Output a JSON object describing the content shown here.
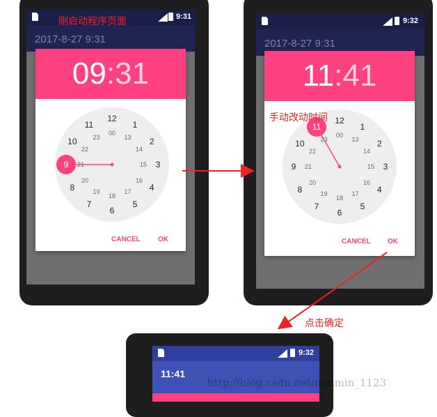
{
  "annotations": {
    "first_launch": "刚启动程序页面",
    "manual_change": "手动改动时间",
    "click_confirm": "点击确定"
  },
  "screen1": {
    "status_time": "9:31",
    "appbar_text": "2017-8-27 9:31",
    "header_hours": "09",
    "header_colon": ":",
    "header_minutes": "31",
    "selected_hour": "9",
    "cancel_label": "CANCEL",
    "ok_label": "OK"
  },
  "screen2": {
    "status_time": "9:32",
    "appbar_text": "2017-8-27 9:31",
    "header_hours": "11",
    "header_colon": ":",
    "header_minutes": "41",
    "selected_hour": "11",
    "cancel_label": "CANCEL",
    "ok_label": "OK"
  },
  "screen3": {
    "status_time": "9:32",
    "appbar_text": "11:41"
  },
  "clock": {
    "outer": [
      "12",
      "1",
      "2",
      "3",
      "4",
      "5",
      "6",
      "7",
      "8",
      "9",
      "10",
      "11"
    ],
    "inner": [
      "00",
      "13",
      "14",
      "15",
      "16",
      "17",
      "18",
      "19",
      "20",
      "21",
      "22",
      "23"
    ]
  },
  "watermark": "http://blog.csdn.net/minmin_1123",
  "colors": {
    "accent": "#ff4081",
    "appbar_dark": "#1f2452",
    "appbar_blue": "#3f51b5",
    "status_dark": "#1a1f4a",
    "annotation": "#ee2222"
  }
}
